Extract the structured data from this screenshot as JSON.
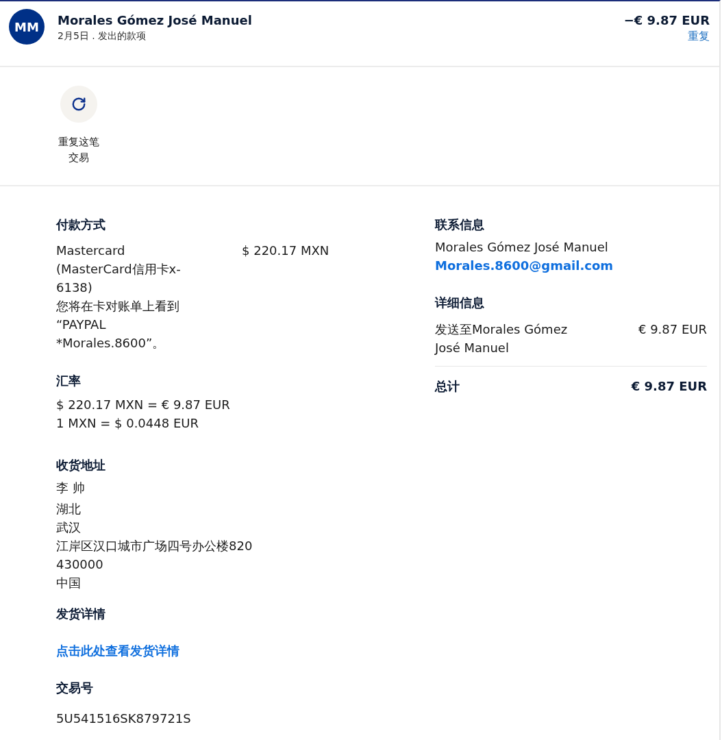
{
  "header": {
    "avatar_initials": "MM",
    "name": "Morales Gómez José Manuel",
    "subtitle": "2月5日 . 发出的款项",
    "amount": "−€ 9.87 EUR",
    "repeat_link": "重复"
  },
  "actions": [
    {
      "label": "重复这笔交易"
    }
  ],
  "payment_method": {
    "heading": "付款方式",
    "card_name": "Mastercard",
    "card_detail": "(MasterCard信用卡x-6138)",
    "statement_note": "您将在卡对账单上看到",
    "statement_descriptor": "“PAYPAL *Morales.8600”。",
    "amount": "$ 220.17 MXN"
  },
  "exchange_rate": {
    "heading": "汇率",
    "lines": [
      "$ 220.17 MXN = € 9.87 EUR",
      "1 MXN = $ 0.0448 EUR"
    ]
  },
  "shipping_address": {
    "heading": "收货地址",
    "recipient": "李 帅",
    "lines": [
      "湖北",
      "武汉",
      "江岸区汉口城市广场四号办公楼820",
      "430000",
      "中国"
    ]
  },
  "shipping_details": {
    "heading": "发货详情",
    "link": "点击此处查看发货详情"
  },
  "transaction_id": {
    "heading": "交易号",
    "value": "5U541516SK879721S"
  },
  "contact_info": {
    "heading": "联系信息",
    "name": "Morales Gómez José Manuel",
    "email": "Morales.8600@gmail.com"
  },
  "details": {
    "heading": "详细信息",
    "items": [
      {
        "label": "发送至Morales Gómez José Manuel",
        "amount": "€ 9.87 EUR"
      }
    ],
    "total": {
      "label": "总计",
      "amount": "€ 9.87 EUR"
    }
  }
}
